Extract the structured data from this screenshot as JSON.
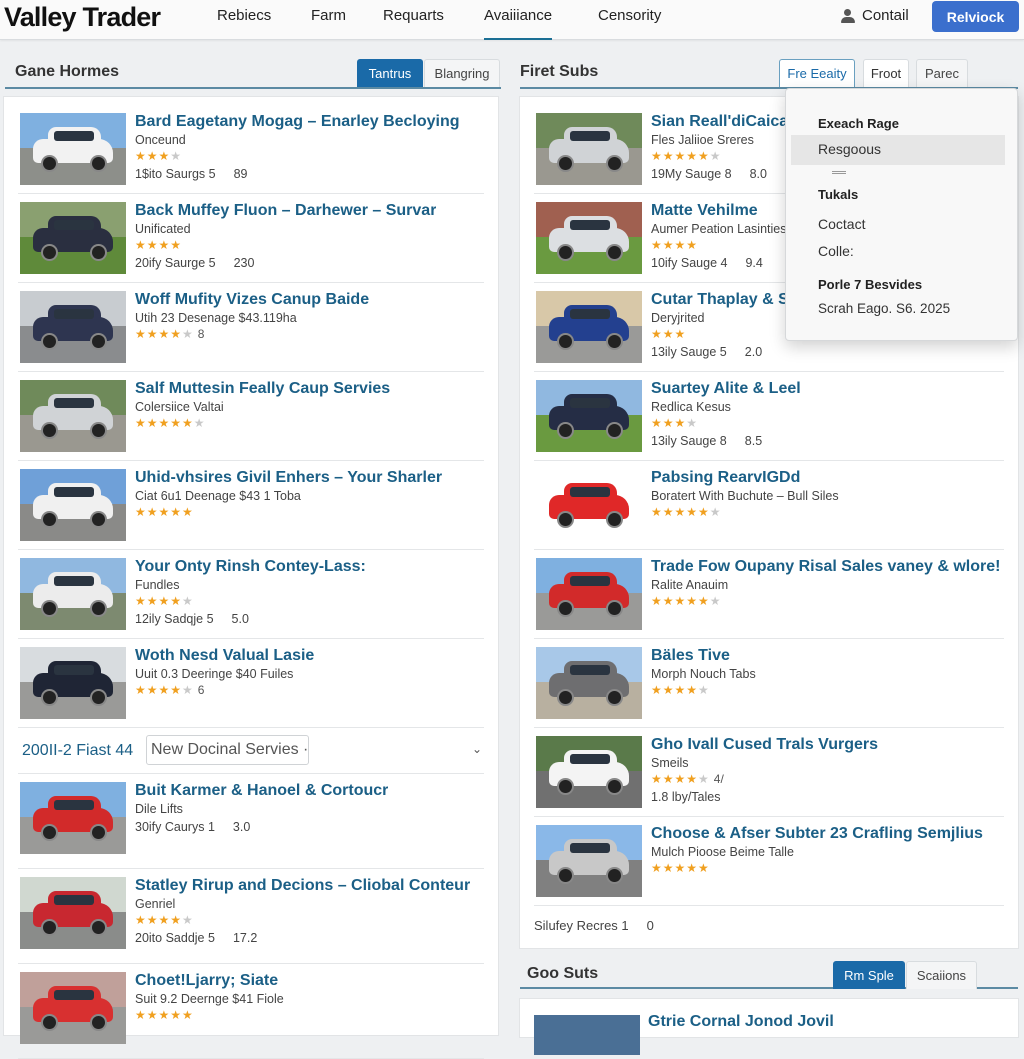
{
  "header": {
    "logo": "Valley Trader",
    "nav": [
      "Rebiecs",
      "Farm",
      "Requarts",
      "Avaiiiance",
      "Censority"
    ],
    "active_nav": "Avaiiiance",
    "contact_label": "Contail",
    "cta_label": "Relviock",
    "accent": "#3b6fcd"
  },
  "left_panel": {
    "title": "Gane Hormes",
    "tabs": [
      {
        "label": "Tantrus",
        "active": true
      },
      {
        "label": "Blangring",
        "active": false
      }
    ],
    "listings": [
      {
        "title": "Bard Eagetany Mogag – Enarley Becloying",
        "sub": "Onceund",
        "stars": 3,
        "half": true,
        "meta": "1$ito Saurgs 5",
        "value": "89",
        "car": "white-suv"
      },
      {
        "title": "Back Muffey Fluon – Darhewer – Survar",
        "sub": "Unificated",
        "stars": 4,
        "half": false,
        "meta": "20ify Saurge 5",
        "value": "230",
        "car": "dark-suv"
      },
      {
        "title": "Woff Mufity Vizes Canup Baide",
        "sub": "Utih 23 Desenage $43.119ha",
        "stars": 4,
        "half": true,
        "count": "8",
        "car": "dark-truck"
      },
      {
        "title": "Salf Muttesin Feally Caup Servies",
        "sub": "Colersiice Valtai",
        "stars": 5,
        "half": true,
        "car": "silver-suv"
      },
      {
        "title": "Uhid-vhsires Givil Enhers – Your Sharler",
        "sub": "Ciat 6u1 Deenage $43 1 Toba",
        "stars": 5,
        "half": false,
        "car": "white-truck"
      },
      {
        "title": "Your Onty Rinsh Contey-Lass:",
        "sub": "Fundles",
        "stars": 4,
        "half": true,
        "meta": "12ily Sadqje 5",
        "value": "5.0",
        "car": "white-truck2"
      },
      {
        "title": "Woth Nesd Valual Lasie",
        "sub": "Uuit 0.3 Deeringe $40 Fuiles",
        "stars": 4,
        "half": true,
        "count": "6",
        "car": "dark-sedan"
      }
    ],
    "filter": {
      "label": "200II-2 Fiast 44",
      "select_value": "New Docinal Servies ·"
    },
    "listings_2": [
      {
        "title": "Buit Karmer & Hanoel & Cortoucr",
        "sub": "Dile Lifts",
        "stars": 0,
        "half": false,
        "meta": "30ify Caurys 1",
        "value": "3.0",
        "car": "red-sedan"
      },
      {
        "title": "Statley Rirup and Decions – Cliobal Conteur",
        "sub": "Genriel",
        "stars": 4,
        "half": true,
        "meta": "20ito Saddje 5",
        "value": "17.2",
        "car": "red-sedan2"
      },
      {
        "title": "Choet!Ljarry; Siate",
        "sub": "Suit 9.2 Deernge $41 Fiole",
        "stars": 5,
        "half": false,
        "car": "red-sedan3"
      }
    ]
  },
  "right_panel": {
    "title": "Firet Subs",
    "tabs": [
      {
        "label": "Fre Eeaity",
        "style": "outlined"
      },
      {
        "label": "Froot",
        "style": "white"
      },
      {
        "label": "Parec",
        "style": "plain"
      }
    ],
    "listings": [
      {
        "title": "Sian Reall'diCaicar",
        "sub": "Fles Jaliioe Sreres",
        "stars": 5,
        "half": true,
        "meta": "19My Sauge 8",
        "value": "8.0",
        "car": "silver-suv"
      },
      {
        "title": "Matte Vehilme",
        "sub": "Aumer Peation Lasinties",
        "stars": 4,
        "half": false,
        "meta": "10ify Sauge 4",
        "value": "9.4",
        "car": "silver-suv2"
      },
      {
        "title": "Cutar Thaplay & S",
        "sub": "Deryjrited",
        "stars": 3,
        "half": false,
        "meta": "13ily Sauge 5",
        "value": "2.0",
        "car": "blue-sedan"
      },
      {
        "title": "Suartey Alite & Leel",
        "sub": "Redlica Kesus",
        "stars": 3,
        "half": true,
        "meta": "13ily Sauge 8",
        "value": "8.5",
        "car": "navy-suv"
      },
      {
        "title": "Pabsing RearvIGDd",
        "sub": "Boratert With Buchute – Bull Siles",
        "stars": 5,
        "half": true,
        "car": "red-sports"
      },
      {
        "title": "Trade Fow Oupany Risal Sales vaney & wlore!",
        "sub": "Ralite Anauim",
        "stars": 5,
        "half": true,
        "car": "red-sedan"
      },
      {
        "title": "Bäles Tive",
        "sub": "Morph Nouch Tabs",
        "stars": 4,
        "half": true,
        "car": "grey-suv"
      },
      {
        "title": "Gho Ivall Cused Trals Vurgers",
        "sub": "Smeils",
        "stars": 4,
        "half": true,
        "count": "4/",
        "meta": "1.8 lby/Tales",
        "car": "white-pickup"
      },
      {
        "title": "Choose & Afser Subter 23 Crafling Semjlius",
        "sub": "Mulch Pioose Beime Talle",
        "stars": 5,
        "half": false,
        "car": "silver-suv-back"
      }
    ],
    "footer": {
      "label": "Silufey Recres 1",
      "value": "0"
    }
  },
  "dropdown": {
    "sections": [
      {
        "heading": "Exeach Rage",
        "items": [
          "Resgoous"
        ],
        "highlighted": "Resgoous"
      },
      {
        "heading": "Tukals",
        "items": [
          "Coctact",
          "Colle:"
        ]
      },
      {
        "heading": "Porle 7 Besvides",
        "items": [
          "Scrah Eago. S6. 2025"
        ]
      }
    ]
  },
  "bottom_panel": {
    "title": "Goo Suts",
    "tabs": [
      {
        "label": "Rm Sple",
        "active": true
      },
      {
        "label": "Scaiions",
        "active": false
      }
    ],
    "partial_title": "Gtrie Cornal Jonod Jovil"
  },
  "colors": {
    "link": "#1b5f86",
    "star": "#f0a020",
    "tab_active": "#1a6aa8"
  }
}
